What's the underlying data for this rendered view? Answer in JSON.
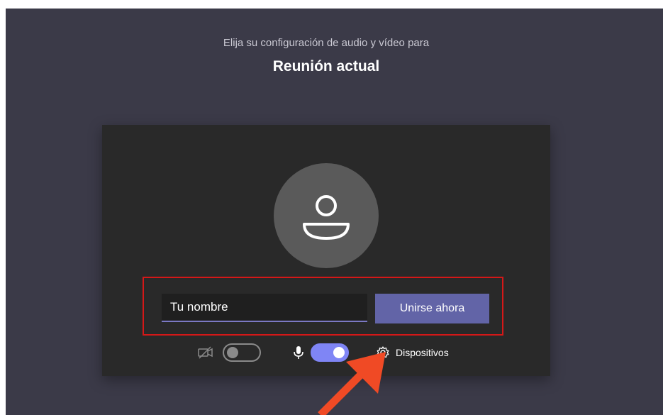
{
  "header": {
    "subtitle": "Elija su configuración de audio y vídeo para",
    "title": "Reunión actual"
  },
  "join": {
    "name_value": "Tu nombre",
    "join_label": "Unirse ahora"
  },
  "controls": {
    "camera_on": false,
    "microphone_on": true,
    "devices_label": "Dispositivos"
  },
  "icons": [
    "avatar-person-icon",
    "camera-off-icon",
    "microphone-icon",
    "gear-icon",
    "annotation-arrow"
  ],
  "colors": {
    "background": "#3b3a48",
    "card": "#292929",
    "accent": "#6264a7",
    "toggle_on": "#7f85f5",
    "highlight": "#d41818",
    "arrow": "#f04a25"
  }
}
